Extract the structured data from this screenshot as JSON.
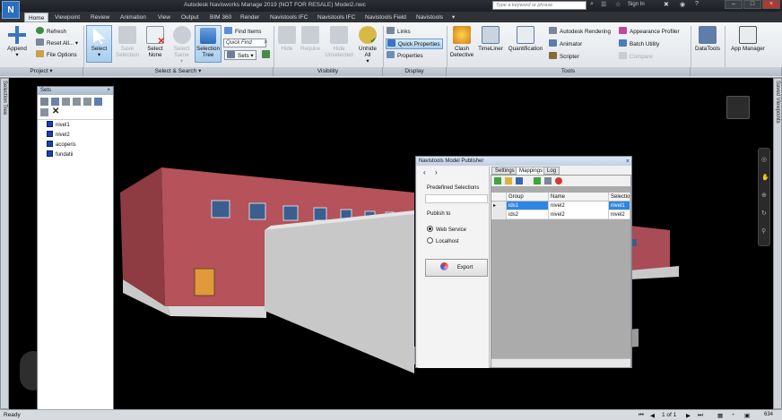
{
  "titlebar": {
    "logo": "N",
    "title": "Autodesk Navisworks Manage 2019 (NOT FOR RESALE)   Model2.nwc",
    "search_placeholder": "Type a keyword or phrase",
    "sign_in": "Sign In"
  },
  "tabs": [
    "Home",
    "Viewpoint",
    "Review",
    "Animation",
    "View",
    "Output",
    "BIM 360",
    "Render",
    "Navistools IFC",
    "Navistools IFC",
    "Navistools Field",
    "Navistools"
  ],
  "active_tab": "Home",
  "ribbon": {
    "project": {
      "append": "Append",
      "refresh": "Refresh",
      "reset_all": "Reset All...",
      "file_options": "File Options",
      "label": "Project"
    },
    "select_search": {
      "select": "Select",
      "save_selection": "Save Selection",
      "select_none": "Select None",
      "select_same": "Select Same",
      "selection_tree": "Selection Tree",
      "find_items": "Find Items",
      "quick_find_placeholder": "Quick Find",
      "sets": "Sets",
      "label": "Select & Search"
    },
    "visibility": {
      "hide": "Hide",
      "require": "Require",
      "hide_unselected": "Hide Unselected",
      "unhide_all": "Unhide All",
      "label": "Visibility"
    },
    "display": {
      "links": "Links",
      "quick_properties": "Quick Properties",
      "properties": "Properties",
      "label": "Display"
    },
    "tools": {
      "clash_detective": "Clash Detective",
      "timeliner": "TimeLiner",
      "quantification": "Quantification",
      "autodesk_rendering": "Autodesk Rendering",
      "animator": "Animator",
      "scripter": "Scripter",
      "appearance_profiler": "Appearance Profiler",
      "batch_utility": "Batch Utility",
      "compare": "Compare",
      "label": "Tools"
    },
    "datatools": "DataTools",
    "app_manager": "App Manager"
  },
  "left_strip_label": "Selection Tree",
  "right_strip_label": "Saved Viewpoints",
  "sets_panel": {
    "title": "Sets",
    "items": [
      "nivel1",
      "nivel2",
      "acoperis",
      "fundatii"
    ]
  },
  "publisher": {
    "title": "Navistools Model Publisher",
    "nav_back": "‹",
    "nav_forward": "›",
    "predefined_label": "Predefined Selections",
    "publish_to_label": "Publish to",
    "options": [
      "Web Service",
      "Localhost"
    ],
    "selected_option": "Web Service",
    "export_label": "Export",
    "tabs": [
      "Settings",
      "Mappings",
      "Log"
    ],
    "active_tab": "Mappings",
    "columns": [
      "Group",
      "Name",
      "Selectio"
    ],
    "rows": [
      [
        "ids1",
        "nivel2",
        "nivel1"
      ],
      [
        "ids2",
        "nivel2",
        "nivel2"
      ]
    ]
  },
  "status": {
    "ready": "Ready",
    "page": "1 of 1",
    "zoom": "634"
  },
  "colors": {
    "accent": "#2f86e0",
    "wall_red": "#b5525a",
    "ribbon_bg": "#e6eaee"
  }
}
